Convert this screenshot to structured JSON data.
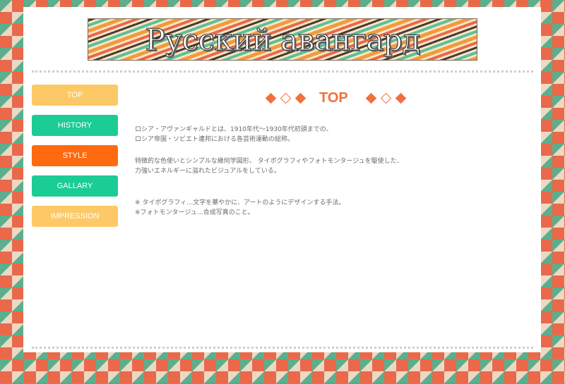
{
  "header": {
    "banner_title": "Русский авангард"
  },
  "nav": {
    "items": [
      {
        "label": "TOP",
        "color": "#fdc966"
      },
      {
        "label": "HISTORY",
        "color": "#1ccc95"
      },
      {
        "label": "STYLE",
        "color": "#ff6a10"
      },
      {
        "label": "GALLARY",
        "color": "#1ccc95"
      },
      {
        "label": "IMPRESSION",
        "color": "#fdc966"
      }
    ]
  },
  "main": {
    "title": "TOP",
    "accent_color": "#f0703e",
    "paragraphs": [
      "ロシア・アヴァンギャルドとは、1910年代〜1930年代初頭までの、",
      "ロシア帝国・ソビエト連邦における各芸術運動の総称。",
      "特徴的な色使いとシンプルな幾何学図形、 タイポグラフィやフォトモンタージュを駆使した、",
      "力強いエネルギーに溢れたビジュアルをしている。",
      "※ タイポグラフィ…文字を華やかに、アートのようにデザインする手法。",
      "※フォトモンタージュ…合成写真のこと。"
    ]
  },
  "colors": {
    "pattern_red": "#e9694a",
    "pattern_green": "#5cae8c",
    "pattern_cream": "#ead9c4"
  }
}
